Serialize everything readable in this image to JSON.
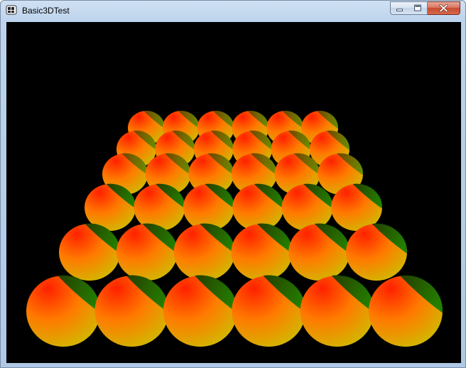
{
  "window": {
    "title": "Basic3DTest"
  },
  "title_buttons": {
    "minimize_icon": "minimize-icon",
    "maximize_icon": "maximize-icon",
    "close_icon": "close-icon"
  },
  "scene": {
    "background": "#000000",
    "rows": 6,
    "columns": 6,
    "sphere_colors": {
      "highlight": "#ff2000",
      "mid": "#ff7a00",
      "rim": "#c8c400",
      "shadow_cap": "#007a00"
    }
  }
}
